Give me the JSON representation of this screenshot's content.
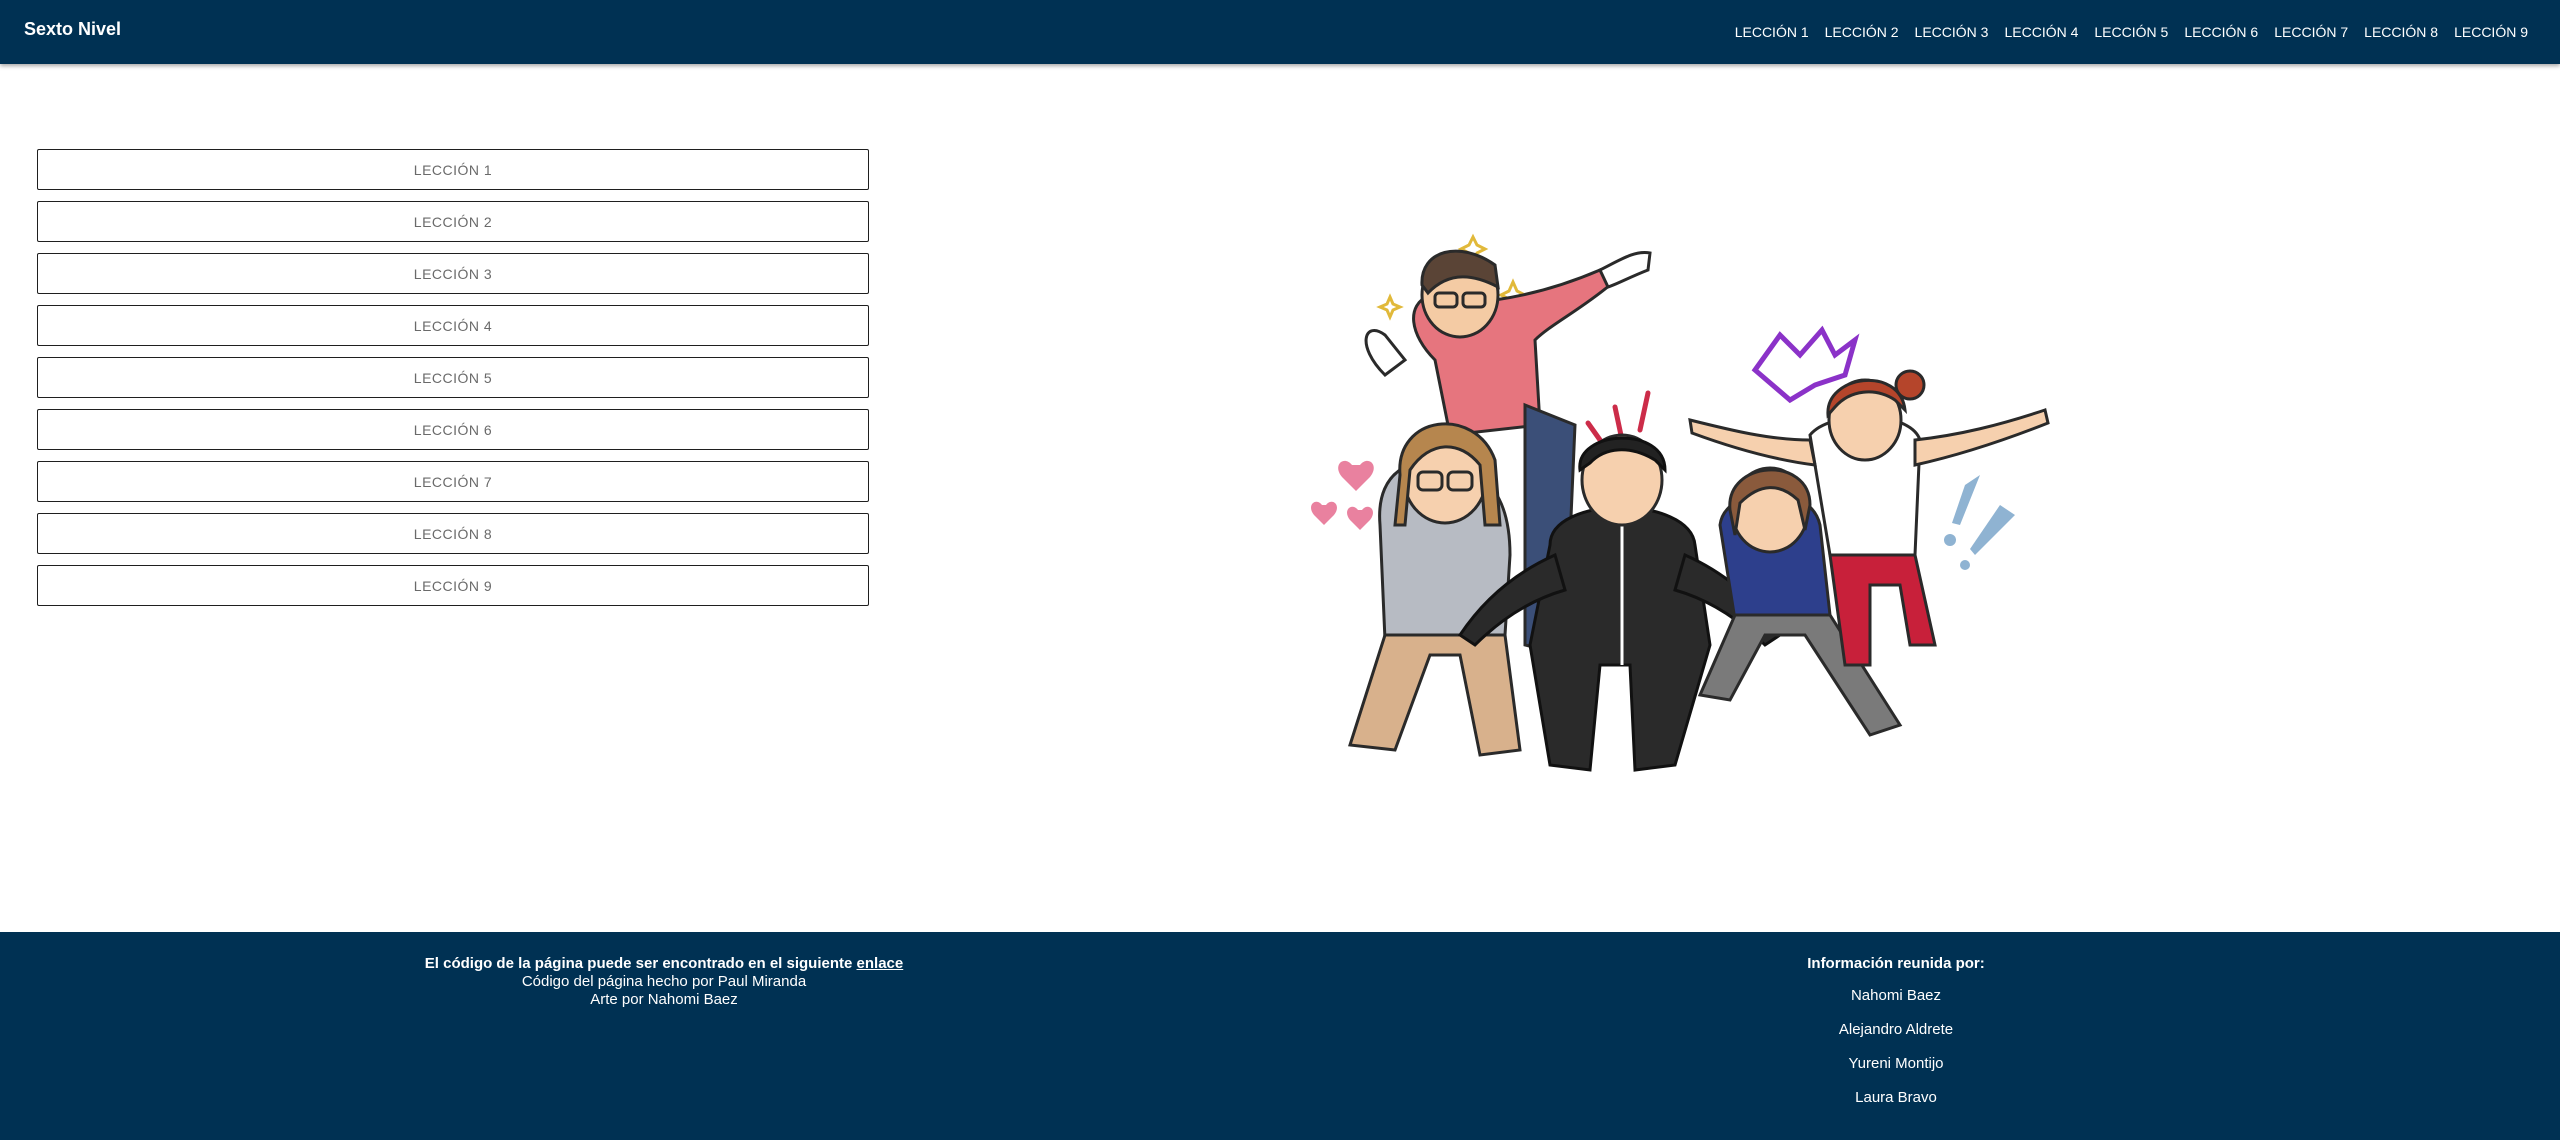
{
  "navbar": {
    "brand": "Sexto Nivel",
    "links": [
      "LECCIÓN 1",
      "LECCIÓN 2",
      "LECCIÓN 3",
      "LECCIÓN 4",
      "LECCIÓN 5",
      "LECCIÓN 6",
      "LECCIÓN 7",
      "LECCIÓN 8",
      "LECCIÓN 9"
    ]
  },
  "main": {
    "lessons": [
      "LECCIÓN 1",
      "LECCIÓN 2",
      "LECCIÓN 3",
      "LECCIÓN 4",
      "LECCIÓN 5",
      "LECCIÓN 6",
      "LECCIÓN 7",
      "LECCIÓN 8",
      "LECCIÓN 9"
    ],
    "illustration_icon": "group-of-cartoon-teachers-illustration"
  },
  "footer": {
    "code_text": "El código de la página puede ser encontrado en el siguiente",
    "code_link": "enlace",
    "made_by": "Código del página hecho por Paul Miranda",
    "art_by": "Arte por Nahomi Baez",
    "info_title": "Información reunida por:",
    "names": [
      "Nahomi Baez",
      "Alejandro Aldrete",
      "Yureni Montijo",
      "Laura Bravo"
    ]
  },
  "colors": {
    "navy": "#003153",
    "button_border": "#1f1f1f",
    "button_text": "#6a6a6a"
  }
}
